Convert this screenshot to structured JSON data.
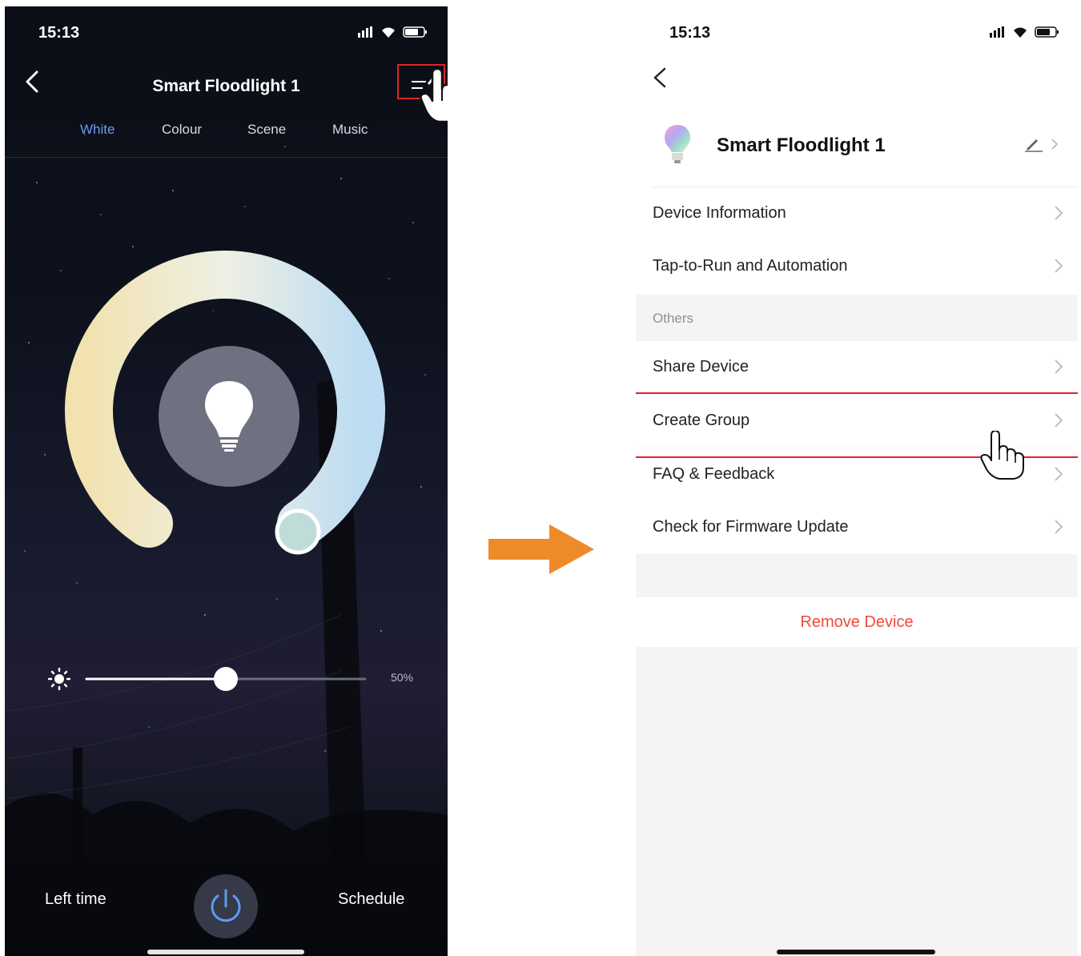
{
  "left_screen": {
    "status_time": "15:13",
    "title": "Smart Floodlight 1",
    "tabs": [
      {
        "label": "White",
        "active": true
      },
      {
        "label": "Colour",
        "active": false
      },
      {
        "label": "Scene",
        "active": false
      },
      {
        "label": "Music",
        "active": false
      }
    ],
    "brightness": {
      "label": "50%",
      "value": 0.5
    },
    "bottom": {
      "left_time": "Left time",
      "schedule": "Schedule"
    }
  },
  "right_screen": {
    "status_time": "15:13",
    "device_name": "Smart Floodlight 1",
    "menu_top": [
      {
        "label": "Device Information"
      },
      {
        "label": "Tap-to-Run and Automation"
      }
    ],
    "section_header": "Others",
    "menu_others": [
      {
        "label": "Share Device"
      },
      {
        "label": "Create Group"
      },
      {
        "label": "FAQ & Feedback"
      },
      {
        "label": "Check for Firmware Update"
      }
    ],
    "remove_label": "Remove Device"
  },
  "colors": {
    "accent_tab": "#6b9bf5",
    "highlight_box": "#e02424",
    "arrow": "#ef8a2b",
    "remove_text": "#ef4a3b"
  },
  "icons": [
    "back-icon",
    "settings-edit-icon",
    "hand-pointer-icon",
    "bulb-icon",
    "sun-icon",
    "power-icon",
    "chevron-right-icon",
    "pencil-icon",
    "signal-icon",
    "wifi-icon",
    "battery-icon"
  ]
}
